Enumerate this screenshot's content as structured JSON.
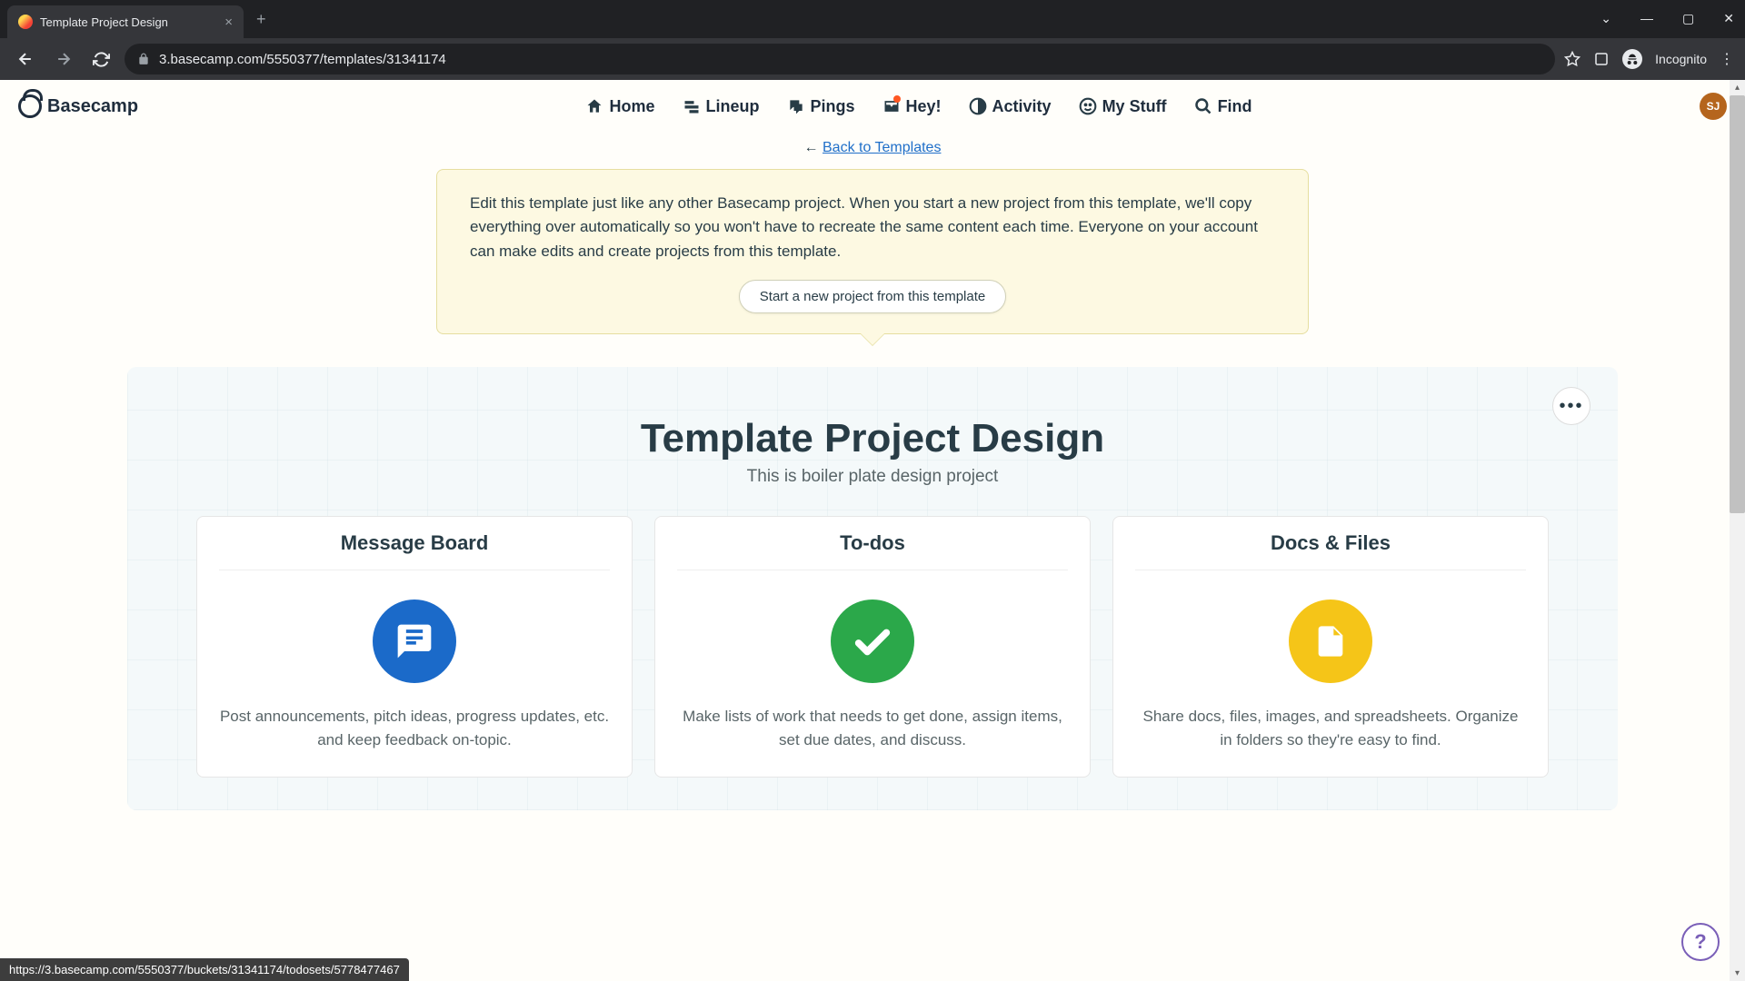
{
  "browser": {
    "tab_title": "Template Project Design",
    "url": "3.basecamp.com/5550377/templates/31341174",
    "incognito_label": "Incognito",
    "status_url": "https://3.basecamp.com/5550377/buckets/31341174/todosets/5778477467"
  },
  "nav": {
    "logo": "Basecamp",
    "items": [
      {
        "label": "Home"
      },
      {
        "label": "Lineup"
      },
      {
        "label": "Pings"
      },
      {
        "label": "Hey!"
      },
      {
        "label": "Activity"
      },
      {
        "label": "My Stuff"
      },
      {
        "label": "Find"
      }
    ],
    "avatar": "SJ"
  },
  "back": {
    "prefix": "← ",
    "link": "Back to Templates"
  },
  "callout": {
    "text": "Edit this template just like any other Basecamp project. When you start a new project from this template, we'll copy everything over automatically so you won't have to recreate the same content each time. Everyone on your account can make edits and create projects from this template.",
    "button": "Start a new project from this template"
  },
  "template": {
    "title": "Template Project Design",
    "subtitle": "This is boiler plate design project"
  },
  "tools": [
    {
      "title": "Message Board",
      "desc": "Post announcements, pitch ideas, progress updates, etc. and keep feedback on-topic."
    },
    {
      "title": "To-dos",
      "desc": "Make lists of work that needs to get done, assign items, set due dates, and discuss."
    },
    {
      "title": "Docs & Files",
      "desc": "Share docs, files, images, and spreadsheets. Organize in folders so they're easy to find."
    }
  ],
  "help": "?"
}
